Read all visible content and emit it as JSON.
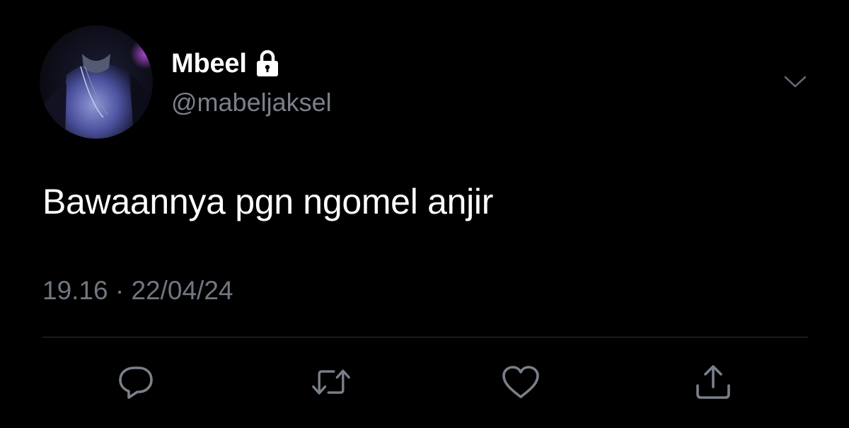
{
  "user": {
    "display_name": "Mbeel",
    "handle": "@mabeljaksel",
    "protected_icon": "lock-icon",
    "avatar_icon": "avatar-photo"
  },
  "tweet": {
    "text": "Bawaannya pgn ngomel anjir",
    "meta": "19.16 · 22/04/24"
  },
  "actions": {
    "reply_icon": "reply-icon",
    "retweet_icon": "retweet-icon",
    "like_icon": "heart-icon",
    "share_icon": "share-icon",
    "more_icon": "chevron-down-icon"
  },
  "colors": {
    "background": "#000000",
    "primary_text": "#ffffff",
    "secondary_text": "#707780",
    "icon": "#7a8089",
    "divider": "#2f3336"
  }
}
